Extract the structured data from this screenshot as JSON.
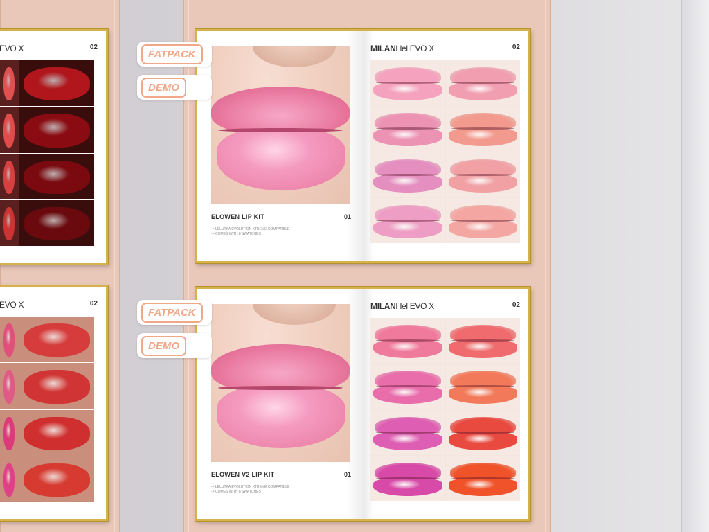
{
  "tags": {
    "fatpack": "FATPACK",
    "demo": "DEMO"
  },
  "left_books": [
    {
      "brand": "EVO X",
      "page": "02",
      "cell_colors": [
        "#e05050",
        "#b0161c",
        "#e14b4b",
        "#8a0c12",
        "#d64040",
        "#7a0a10",
        "#cc3333",
        "#6a0a0e"
      ]
    },
    {
      "brand": "EVO X",
      "page": "02",
      "cell_colors": [
        "#e0507a",
        "#d63c3c",
        "#e05a86",
        "#d03434",
        "#dc3a7a",
        "#cf2f2f",
        "#e04088",
        "#d63a30"
      ]
    }
  ],
  "books": [
    {
      "kit_title": "ELOWEN LIP KIT",
      "kit_page": "01",
      "notes": [
        "-> LELUTKA EVOLUTION XTREME COMPATIBLE",
        "-> COMES WITH 8 SWATCHES"
      ],
      "brand_bold": "MILANI",
      "brand_rest": "lel EVO X",
      "page": "02",
      "swatches": [
        "#f4a2bd",
        "#f19fb0",
        "#ec93b4",
        "#f29a8e",
        "#e48fbf",
        "#f1a0a4",
        "#ee9ec4",
        "#f3a6a2"
      ]
    },
    {
      "kit_title": "ELOWEN V2 LIP KIT",
      "kit_page": "01",
      "notes": [
        "-> LELUTKA EVOLUTION XTREME COMPATIBLE",
        "-> COMES WITH 8 SWATCHES"
      ],
      "brand_bold": "MILANI",
      "brand_rest": "lel EVO X",
      "page": "02",
      "swatches": [
        "#f07a9c",
        "#ef6b6d",
        "#e96dab",
        "#f27a5a",
        "#dd5eb2",
        "#e94a3f",
        "#d84aa8",
        "#f0522a"
      ]
    }
  ]
}
